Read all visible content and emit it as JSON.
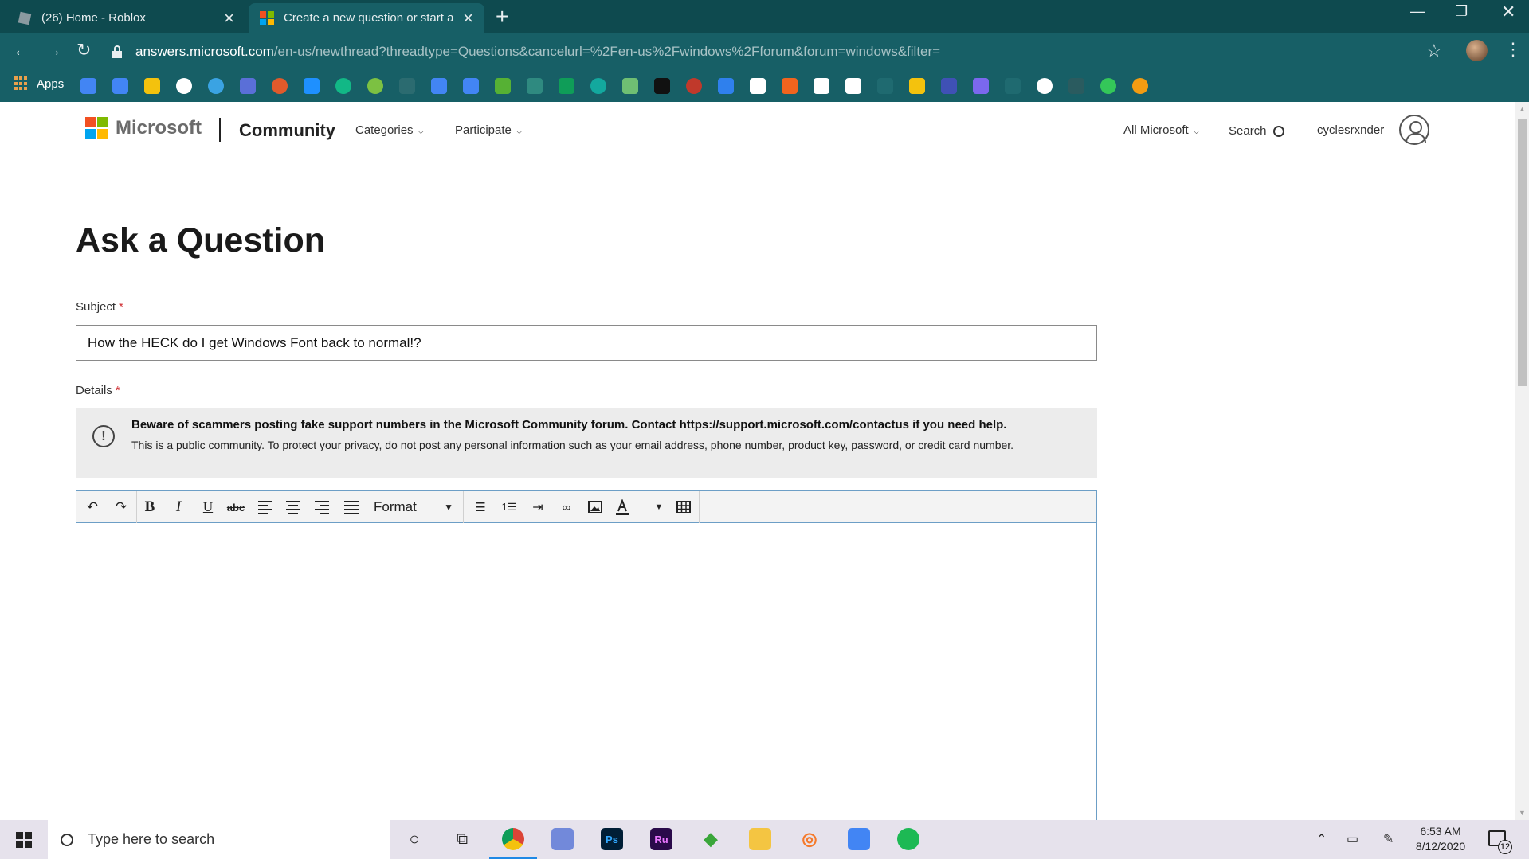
{
  "browser": {
    "tabs": [
      {
        "title": "(26) Home - Roblox",
        "active": false
      },
      {
        "title": "Create a new question or start a c",
        "active": true
      }
    ],
    "url_host": "answers.microsoft.com",
    "url_rest": "/en-us/newthread?threadtype=Questions&cancelurl=%2Fen-us%2Fwindows%2Fforum&forum=windows&filter=",
    "bookmarks_label": "Apps",
    "colors": {
      "chrome_dark": "#0e4a4f",
      "chrome": "#175f66"
    }
  },
  "site": {
    "brand": "Microsoft",
    "section": "Community",
    "nav": [
      "Categories",
      "Participate"
    ],
    "all_microsoft": "All Microsoft",
    "search_label": "Search",
    "username": "cyclesrxnder"
  },
  "form": {
    "heading": "Ask a Question",
    "subject_label": "Subject",
    "subject_value": "How the HECK do I get Windows Font back to normal!?",
    "details_label": "Details",
    "required_mark": "*",
    "notice_bold": "Beware of scammers posting fake support numbers in the Microsoft Community forum. Contact https://support.microsoft.com/contactus if you need help.",
    "notice_text": "This is a public community. To protect your privacy, do not post any personal information such as your email address, phone number, product key, password, or credit card number.",
    "format_label": "Format",
    "editor_buttons": [
      "undo-icon",
      "redo-icon",
      "bold",
      "italic",
      "underline",
      "strikethrough",
      "align-left",
      "align-center",
      "align-right",
      "justify",
      "format",
      "bullet-list",
      "numbered-list",
      "indent",
      "link",
      "image",
      "font-color",
      "table"
    ]
  },
  "taskbar": {
    "search_placeholder": "Type here to search",
    "time": "6:53 AM",
    "date": "8/12/2020",
    "notification_count": "12"
  }
}
